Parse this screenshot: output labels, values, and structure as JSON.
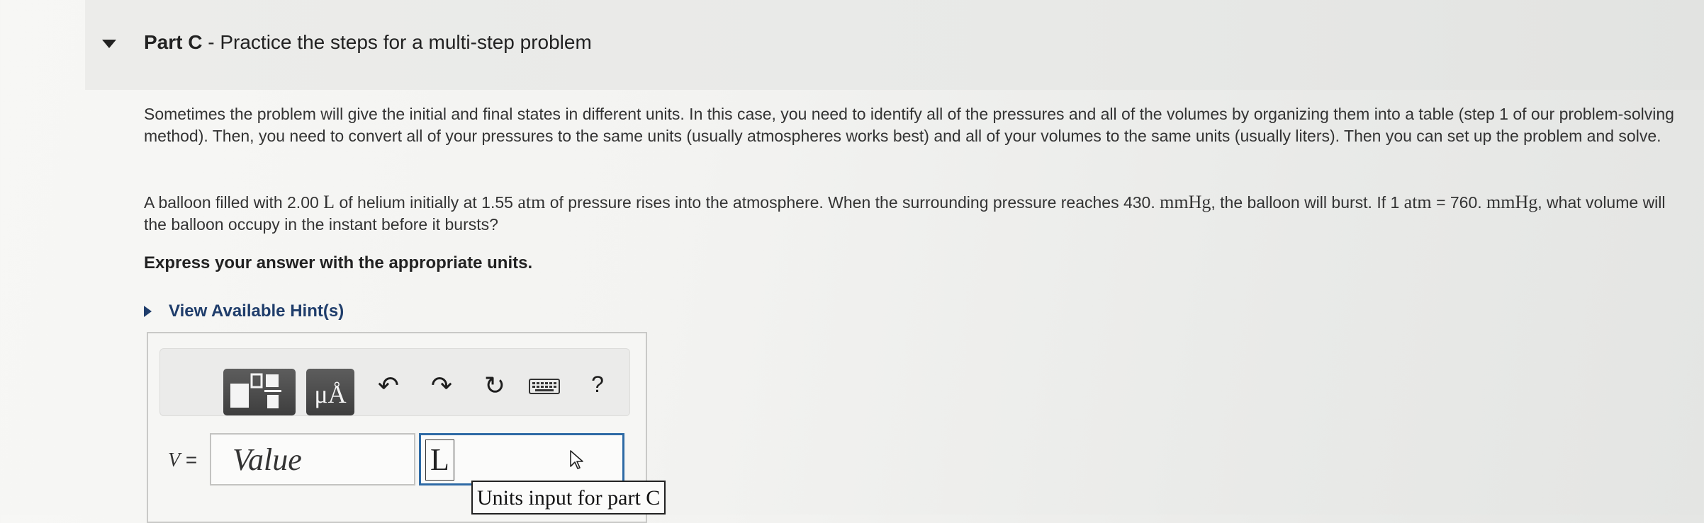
{
  "part": {
    "label": "Part C",
    "separator": "-",
    "title": "Practice the steps for a multi-step problem"
  },
  "intro_text": "Sometimes the problem will give the initial and final states in different units. In this case, you need to identify all of the pressures and all of the volumes by organizing them into a table (step 1 of our problem-solving method). Then, you need to convert all of your pressures to the same units (usually atmospheres works best) and all of your volumes to the same units (usually liters). Then you can set up the problem and solve.",
  "problem": {
    "t1": "A balloon filled with 2.00",
    "u1": "L",
    "t2": "of helium initially at 1.55",
    "u2": "atm",
    "t3": "of pressure rises into the atmosphere. When the surrounding pressure reaches 430.",
    "u3": "mmHg",
    "t4": ", the balloon will burst. If 1",
    "u4": "atm",
    "t5": "= 760.",
    "u5": "mmHg",
    "t6": ", what volume will the balloon occupy in the instant before it bursts?"
  },
  "instruction": "Express your answer with the appropriate units.",
  "hints_label": "View Available Hint(s)",
  "toolbar": {
    "units_glyph": "μÅ",
    "undo_glyph": "↶",
    "redo_glyph": "↷",
    "reset_glyph": "↻",
    "help_glyph": "?"
  },
  "answer": {
    "variable": "V",
    "equals": "=",
    "value_placeholder": "Value",
    "units_value": "L",
    "units_tooltip": "Units input for part C"
  },
  "colors": {
    "link": "#1f3d6b",
    "focus_border": "#2e6aa5"
  }
}
